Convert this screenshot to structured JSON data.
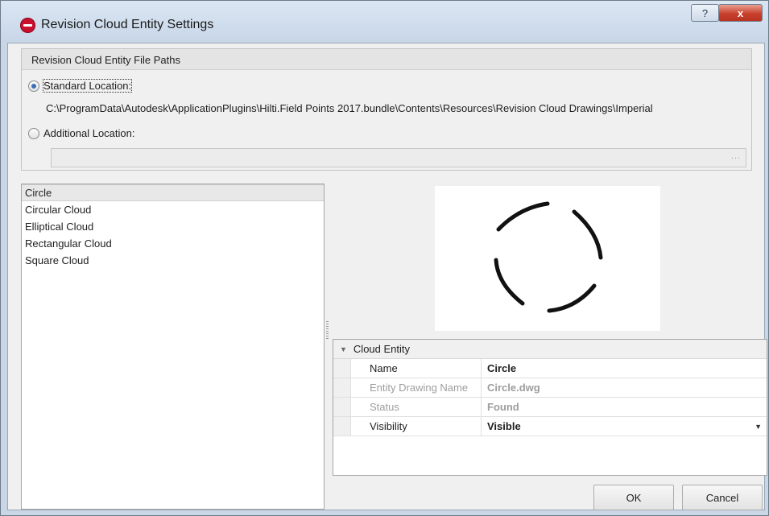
{
  "window": {
    "title": "Revision Cloud Entity Settings",
    "help_label": "?",
    "close_label": "x"
  },
  "paths": {
    "group_title": "Revision Cloud Entity File Paths",
    "standard_label": "Standard Location:",
    "standard_checked": true,
    "standard_path": "C:\\ProgramData\\Autodesk\\ApplicationPlugins\\Hilti.Field Points 2017.bundle\\Contents\\Resources\\Revision Cloud Drawings\\Imperial",
    "additional_label": "Additional Location:",
    "additional_checked": false,
    "additional_value": "",
    "browse_label": "..."
  },
  "entities": {
    "items": [
      "Circle",
      "Circular Cloud",
      "Elliptical Cloud",
      "Rectangular Cloud",
      "Square Cloud"
    ],
    "selected": "Circle"
  },
  "preview": {
    "icon": "dashed-circle-preview"
  },
  "properties": {
    "category": "Cloud Entity",
    "rows": [
      {
        "name": "Name",
        "value": "Circle",
        "dim": false
      },
      {
        "name": "Entity Drawing Name",
        "value": "Circle.dwg",
        "dim": true
      },
      {
        "name": "Status",
        "value": "Found",
        "dim": true
      },
      {
        "name": "Visibility",
        "value": "Visible",
        "dim": false
      }
    ]
  },
  "buttons": {
    "ok": "OK",
    "cancel": "Cancel"
  },
  "colors": {
    "accent": "#3b6fb6",
    "logo": "#c8102e",
    "close": "#c8412e"
  }
}
